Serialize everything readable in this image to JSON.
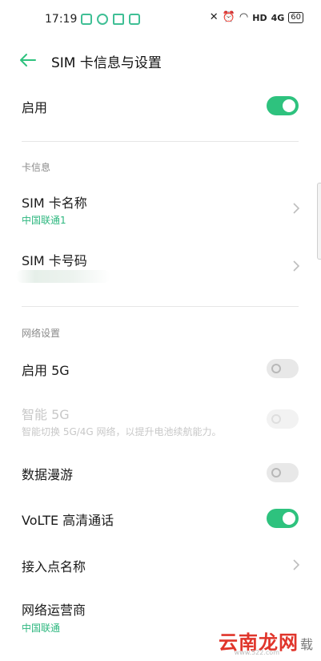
{
  "status_bar": {
    "time": "17:19",
    "hd": "HD",
    "signal": "4G",
    "battery": "60",
    "accent": "#3fbf95"
  },
  "header": {
    "title": "SIM 卡信息与设置",
    "back_icon": "arrow-left-icon",
    "accent": "#2ec27e"
  },
  "enable": {
    "label": "启用",
    "state": "on"
  },
  "card_info": {
    "section_title": "卡信息",
    "sim_name": {
      "label": "SIM 卡名称",
      "value": "中国联通1"
    },
    "sim_number": {
      "label": "SIM 卡号码"
    }
  },
  "network": {
    "section_title": "网络设置",
    "enable_5g": {
      "label": "启用 5G",
      "state": "off"
    },
    "smart_5g": {
      "label": "智能 5G",
      "description": "智能切换 5G/4G 网络，以提升电池续航能力。",
      "state": "disabled"
    },
    "data_roaming": {
      "label": "数据漫游",
      "state": "off"
    },
    "volte": {
      "label": "VoLTE 高清通话",
      "state": "on"
    },
    "apn": {
      "label": "接入点名称"
    },
    "operator": {
      "label": "网络运营商",
      "value": "中国联通"
    }
  },
  "watermark": {
    "text": "云南龙网",
    "side": "载",
    "url": "www.522.com"
  }
}
